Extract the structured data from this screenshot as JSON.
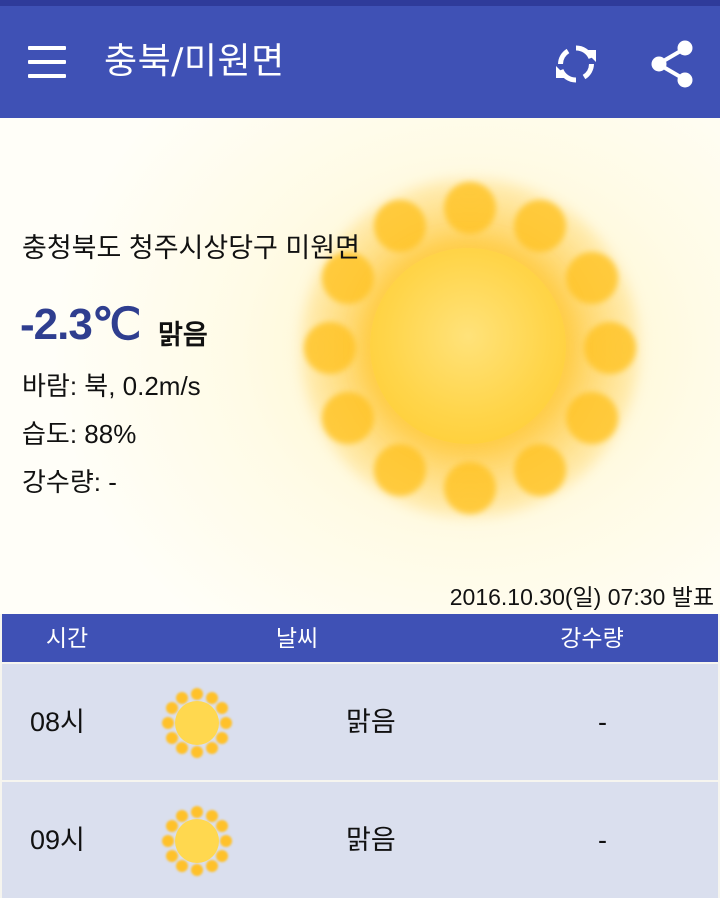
{
  "app": {
    "title": "충북/미원면",
    "menu_icon": "hamburger-menu-icon",
    "refresh_icon": "refresh-icon",
    "share_icon": "share-icon"
  },
  "current": {
    "location": "충청북도 청주시상당구 미원면",
    "temperature": "-2.3℃",
    "condition": "맑음",
    "wind": "바람: 북, 0.2m/s",
    "humidity": "습도:  88%",
    "precipitation": "강수량: -",
    "published": "2016.10.30(일) 07:30 발표",
    "weather_icon": "sun-icon"
  },
  "table": {
    "headers": [
      "시간",
      "날씨",
      "강수량"
    ],
    "rows": [
      {
        "time": "08시",
        "icon": "sun-icon",
        "condition": "맑음",
        "precip": "-"
      },
      {
        "time": "09시",
        "icon": "sun-icon",
        "condition": "맑음",
        "precip": "-"
      }
    ]
  },
  "colors": {
    "primary": "#3f51b5",
    "primary_dark": "#2f3b9a",
    "temp_text": "#2f3e8f",
    "row_bg": "#dadfee",
    "sun": "#ffcb2e"
  }
}
